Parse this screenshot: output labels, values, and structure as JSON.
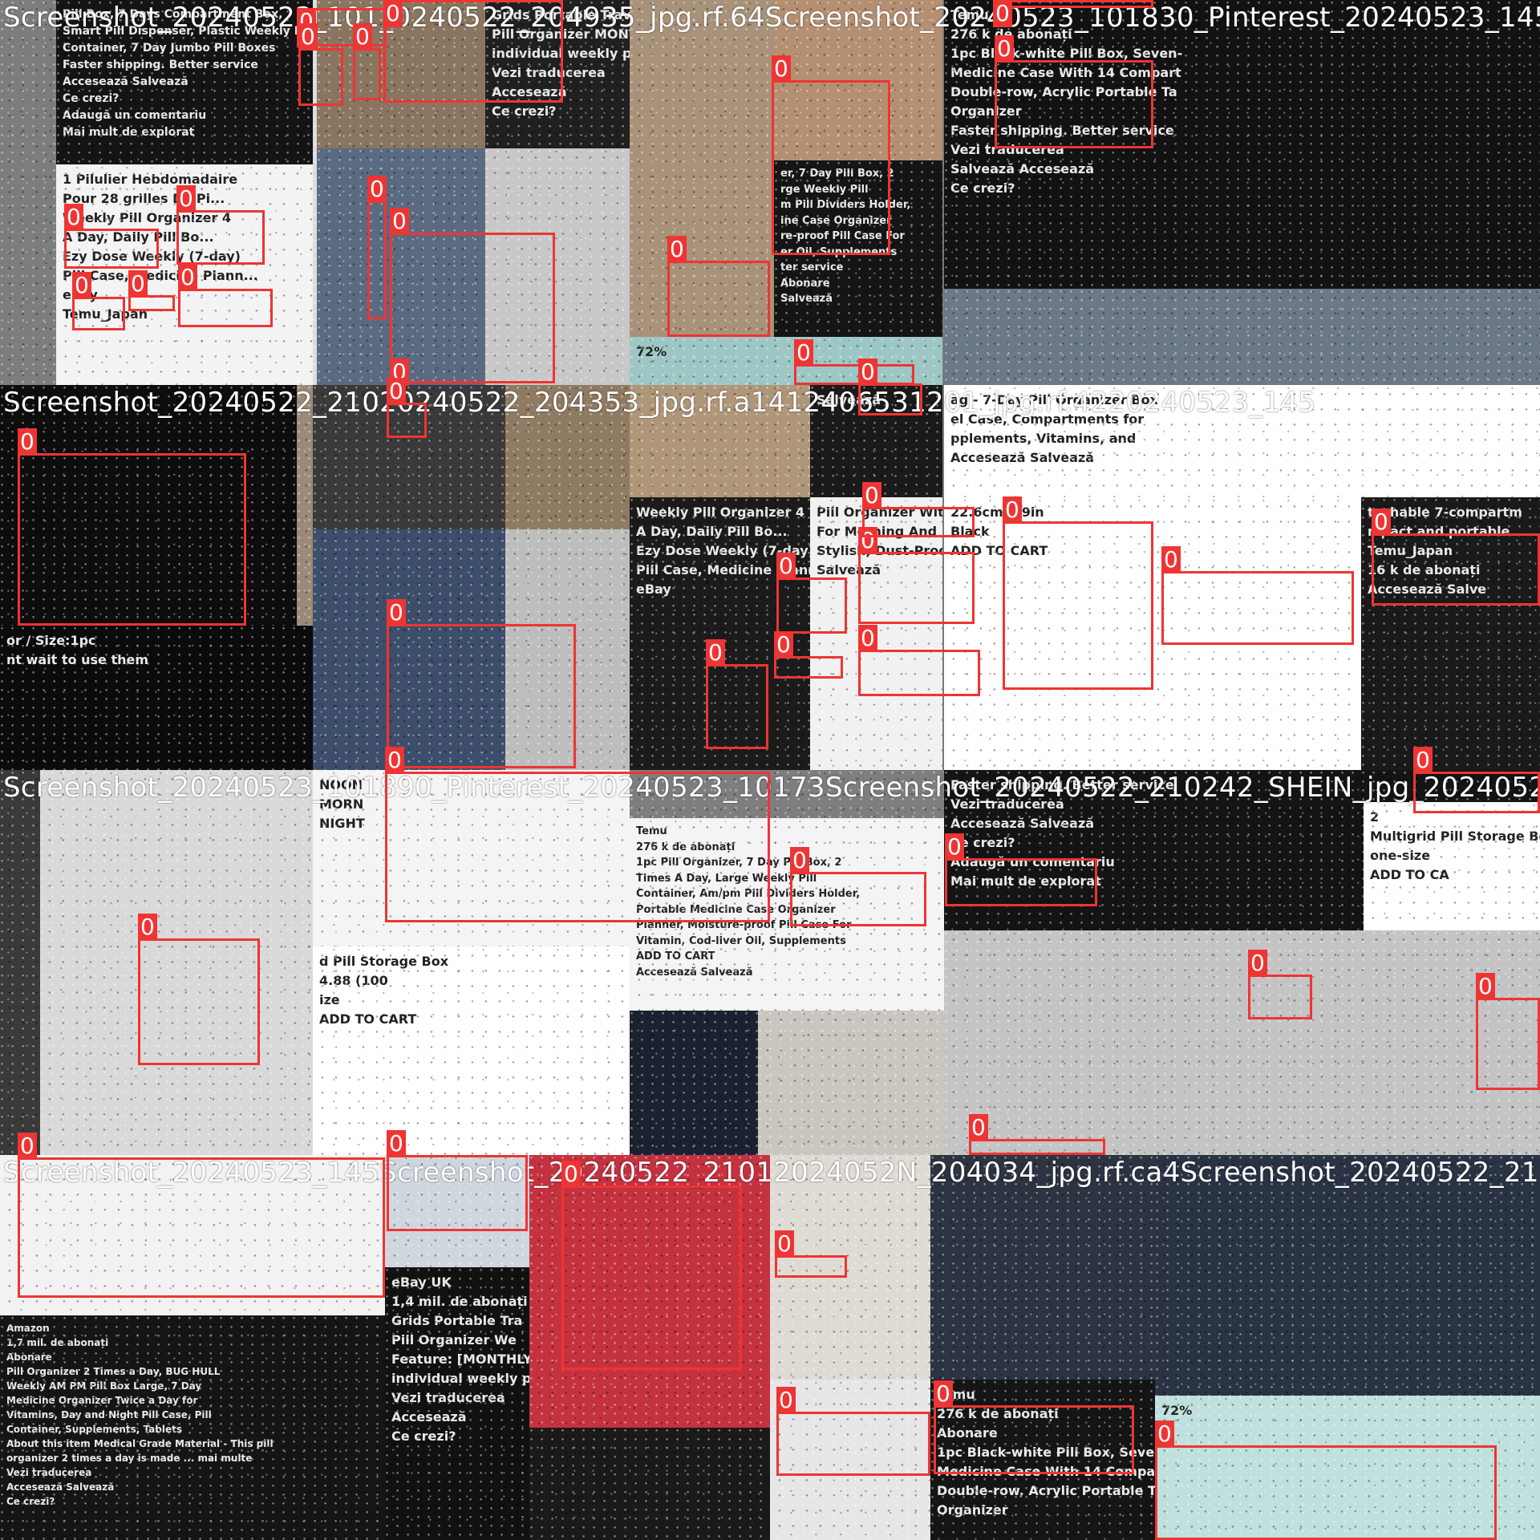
{
  "detection_label": "0",
  "colors": {
    "box": "#ef3434",
    "title": "#ffffff"
  },
  "tiles": [
    {
      "title": "Screenshot_20240522_101_0240522_204935_jpg.rf.64Screenshot_20240523_101830_Pinterest_20240523_145",
      "regions": [
        {
          "bg": "#7d7d7d",
          "lines": []
        },
        {
          "bg": "#141414",
          "lines": [
            "Pill Box, 7 Days Compartment Box,",
            "Smart Pill Dispenser, Plastic Weekly Pill",
            "Container, 7 Day Jumbo Pill Boxes",
            "Faster shipping. Better service",
            "Accesează   Salvează",
            "Ce crezi?",
            "Adaugă un comentariu",
            "Mai mult de explorat"
          ]
        },
        {
          "bg": "#f3f3f3",
          "lines": [
            "1 Pilulier Hebdomadaire",
            "Pour 28 grilles De Pi...",
            "Weekly Pill Organizer 4",
            "A Day, Daily Pill Bo...",
            "Ezy Dose Weekly (7-day)",
            "Pill Case, Medicine Plann...",
            "eBay",
            "Temu_Japan"
          ]
        },
        {
          "bg": "#dcdcdc",
          "lines": []
        },
        {
          "bg": "#8a7560",
          "lines": []
        },
        {
          "bg": "#202020",
          "lines": [
            "Grids Portable Travel",
            "Pill Organizer MONTHLY",
            "individual weekly pill box",
            "Vezi traducerea",
            "Accesează",
            "Ce crezi?"
          ]
        },
        {
          "bg": "#5a6a80",
          "lines": []
        },
        {
          "bg": "#c8c8c8",
          "lines": []
        },
        {
          "bg": "#a8927a",
          "lines": []
        },
        {
          "bg": "#b48f72",
          "lines": []
        },
        {
          "bg": "#151515",
          "lines": [
            "er, 7 Day Pill Box, 2",
            "rge Weekly Pill",
            "m Pill Dividers Holder,",
            "ine Case Organizer",
            "re-proof Pill Case For",
            "er Oil, Supplements",
            "ter service",
            "Abonare",
            "Salvează"
          ]
        },
        {
          "bg": "#9dc7c4",
          "lines": [
            "72%"
          ]
        },
        {
          "bg": "#121212",
          "lines": [
            "Temu",
            "276 k de abonați",
            "1pc Black-white Pill Box, Seven-",
            "Medicine Case With 14 Compart",
            "Double-row, Acrylic Portable Ta",
            "Organizer",
            "Faster shipping. Better service",
            "Vezi traducerea",
            "Salvează   Accesează",
            "Ce crezi?"
          ]
        },
        {
          "bg": "#6b7888",
          "lines": []
        }
      ],
      "boxes": [
        {
          "l": "0"
        },
        {
          "l": "0"
        },
        {
          "l": "0"
        },
        {
          "l": "0"
        },
        {
          "l": "0"
        },
        {
          "l": "0"
        },
        {
          "l": "0"
        },
        {
          "l": "0"
        },
        {
          "l": "0"
        },
        {
          "l": "0"
        },
        {
          "l": "0"
        },
        {
          "l": "0"
        },
        {
          "l": "0"
        },
        {
          "l": "0"
        },
        {
          "l": "0"
        },
        {
          "l": "0"
        },
        {
          "l": "0"
        }
      ]
    },
    {
      "title": "Screenshot_20240522_21020240522_204353_jpg.rf.a1412406531201_jpg.rf.4220240523_145",
      "regions": [
        {
          "bg": "#0d0d0d",
          "lines": []
        },
        {
          "bg": "#9c8a78",
          "lines": []
        },
        {
          "bg": "#0b0b0b",
          "lines": [
            "or / Size:1pc",
            "nt wait to use them"
          ]
        },
        {
          "bg": "#3a3a3a",
          "lines": []
        },
        {
          "bg": "#8f7a62",
          "lines": []
        },
        {
          "bg": "#3d4e6a",
          "lines": []
        },
        {
          "bg": "#bdbdbd",
          "lines": []
        },
        {
          "bg": "#b09678",
          "lines": []
        },
        {
          "bg": "#1a1a1a",
          "lines": [
            "Salvează"
          ]
        },
        {
          "bg": "#1b1b1b",
          "lines": [
            "Weekly Pill Organizer 4",
            "A Day, Daily Pill Bo...",
            "Ezy Dose Weekly (7-day)",
            "Pill Case, Medicine Plann...",
            "eBay"
          ]
        },
        {
          "bg": "#f1f1f1",
          "lines": [
            "Pill Organizer With",
            "For Morning And",
            "Stylish, Dust-Proof,",
            "Salvează"
          ]
        },
        {
          "bg": "#ffffff",
          "lines": [
            "ag - 7-Day Pill Organizer Box",
            "el Case, Compartments for",
            "pplements, Vitamins, and",
            "Accesează   Salvează"
          ]
        },
        {
          "bg": "#ffffff",
          "lines": [
            "22.6cm/8.9in",
            "Black",
            "ADD TO CART"
          ]
        },
        {
          "bg": "#1a1a1a",
          "lines": [
            "tachable 7-compartm",
            "mpact and portable",
            "Temu_Japan",
            "16 k de abonați",
            "Accesează   Salve"
          ]
        }
      ],
      "boxes": [
        {
          "l": "0"
        },
        {
          "l": "0"
        },
        {
          "l": "0"
        },
        {
          "l": "0"
        },
        {
          "l": "0"
        },
        {
          "l": "0"
        },
        {
          "l": "0"
        },
        {
          "l": "0"
        },
        {
          "l": "0"
        },
        {
          "l": "0"
        },
        {
          "l": "0"
        },
        {
          "l": "0"
        },
        {
          "l": "0"
        }
      ]
    },
    {
      "title": "Screenshot_20240523_101890_Pinterest_20240523_10173Screenshot_20240522_210242_SHEIN_jpg_20240523_101",
      "regions": [
        {
          "bg": "#3a3a3a",
          "lines": []
        },
        {
          "bg": "#d9d9d9",
          "lines": []
        },
        {
          "bg": "#f4f4f4",
          "lines": [
            "NOON",
            "MORN",
            "NIGHT"
          ]
        },
        {
          "bg": "#ffffff",
          "lines": [
            "d Pill Storage Box",
            "4.88 (100",
            "ize",
            "ADD TO CART"
          ]
        },
        {
          "bg": "#7e7e7e",
          "lines": []
        },
        {
          "bg": "#f4f4f4",
          "lines": [
            "Temu",
            "276 k de abonați",
            "1pc Pill Organizer, 7 Day Pill Box, 2",
            "Times A Day, Large Weekly Pill",
            "Container, Am/pm Pill Dividers Holder,",
            "Portable Medicine Case Organizer",
            "Planner, Moisture-proof Pill Case For",
            "Vitamin, Cod-liver Oil, Supplements",
            "ADD TO CART",
            "Accesează   Salvează"
          ]
        },
        {
          "bg": "#1a2230",
          "lines": []
        },
        {
          "bg": "#c9c5bf",
          "lines": []
        },
        {
          "bg": "#141414",
          "lines": [
            "Faster shipping. Better service",
            "Vezi traducerea",
            "Accesează   Salvează",
            "Ce crezi?",
            "Adaugă un comentariu",
            "Mai mult de explorat"
          ]
        },
        {
          "bg": "#ffffff",
          "lines": [
            "2",
            "Multigrid Pill Storage Box",
            "one-size",
            "ADD TO CA"
          ]
        },
        {
          "bg": "#c4c4c4",
          "lines": []
        }
      ],
      "boxes": [
        {
          "l": "0"
        },
        {
          "l": "0"
        },
        {
          "l": "0"
        },
        {
          "l": "0"
        },
        {
          "l": "0"
        },
        {
          "l": "0"
        },
        {
          "l": "0"
        },
        {
          "l": "0"
        }
      ]
    },
    {
      "title": "Screenshot_20240523_145Screenshot_20240522_21012024052N_204034_jpg.rf.ca4Screenshot_20240522_2101",
      "regions": [
        {
          "bg": "#f2f2f2",
          "lines": []
        },
        {
          "bg": "#151515",
          "lines": [
            "Amazon",
            "1,7 mil. de abonați",
            "Abonare",
            "Pill Organizer 2 Times a Day, BUG HULL",
            "Weekly AM PM Pill Box Large, 7 Day",
            "Medicine Organizer Twice a Day for",
            "Vitamins, Day and Night Pill Case, Pill",
            "Container, Supplements, Tablets",
            "About this item Medical Grade Material - This pill",
            "organizer 2 times a day is made ... mai multe",
            "Vezi traducerea",
            "Accesează   Salvează",
            "Ce crezi?"
          ]
        },
        {
          "bg": "#cfd6de",
          "lines": []
        },
        {
          "bg": "#111111",
          "lines": [
            "eBay UK",
            "1,4 mil. de abonați",
            "Grids Portable Tra",
            "Pill Organizer We",
            "Feature: [MONTHLY P",
            "individual weekly pill box",
            "Vezi traducerea",
            "Accesează",
            "Ce crezi?"
          ]
        },
        {
          "bg": "#c43240",
          "lines": []
        },
        {
          "bg": "#1a1a1a",
          "lines": []
        },
        {
          "bg": "#dedad4",
          "lines": []
        },
        {
          "bg": "#2c3442",
          "lines": []
        },
        {
          "bg": "#e6e6e6",
          "lines": []
        },
        {
          "bg": "#151515",
          "lines": [
            "Temu",
            "276 k de abonați",
            "Abonare",
            "1pc Black-white Pill Box, Seven-day",
            "Medicine Case With 14 Compartments,",
            "Double-row, Acrylic Portable Tablet",
            "Organizer"
          ]
        },
        {
          "bg": "#2a3344",
          "lines": []
        },
        {
          "bg": "#bfe0dc",
          "lines": [
            "72%"
          ]
        }
      ],
      "boxes": [
        {
          "l": "0"
        },
        {
          "l": "0"
        },
        {
          "l": "0"
        },
        {
          "l": "0"
        },
        {
          "l": "0"
        },
        {
          "l": "0"
        },
        {
          "l": "0"
        }
      ]
    }
  ]
}
